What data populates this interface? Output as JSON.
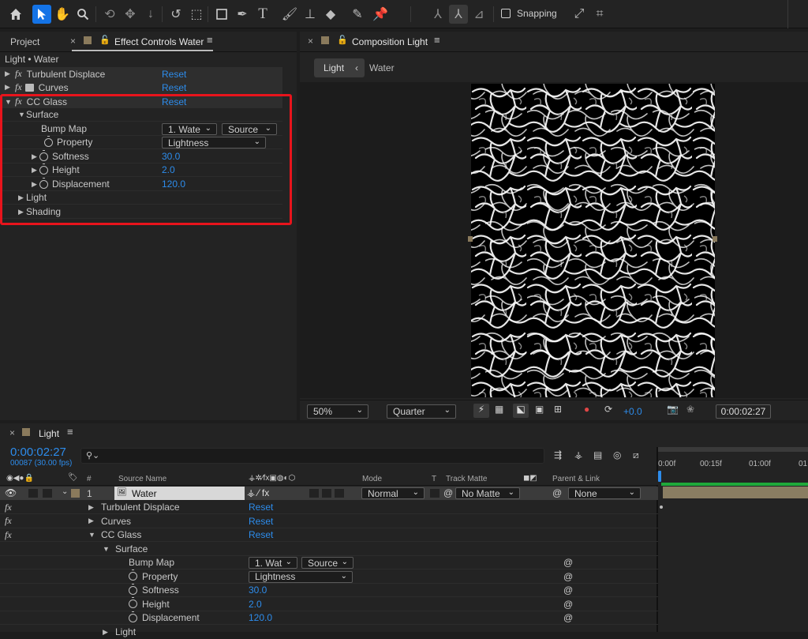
{
  "toolbar": {
    "snapping_label": "Snapping",
    "icons": [
      "home-icon",
      "selection-tool-icon",
      "hand-tool-icon",
      "zoom-tool-icon",
      "orbit-camera-icon",
      "pan-camera-icon",
      "dolly-camera-icon",
      "rotate-tool-icon",
      "pan-behind-icon",
      "rectangle-tool-icon",
      "pen-tool-icon",
      "type-tool-icon",
      "brush-tool-icon",
      "clone-stamp-icon",
      "eraser-icon",
      "roto-brush-icon",
      "puppet-pin-icon"
    ]
  },
  "left_panel": {
    "tab_project": "Project",
    "tab_effect_controls": "Effect Controls Water",
    "breadcrumb": "Light • Water",
    "effects": [
      {
        "name": "Turbulent Displace",
        "reset": "Reset"
      },
      {
        "name": "Curves",
        "reset": "Reset"
      },
      {
        "name": "CC Glass",
        "reset": "Reset"
      }
    ],
    "surface": {
      "label": "Surface",
      "bump_map_label": "Bump Map",
      "bump_map_value": "1. Wate",
      "bump_map_source": "Source",
      "property_label": "Property",
      "property_value": "Lightness",
      "softness_label": "Softness",
      "softness_value": "30.0",
      "height_label": "Height",
      "height_value": "2.0",
      "displacement_label": "Displacement",
      "displacement_value": "120.0"
    },
    "light_label": "Light",
    "shading_label": "Shading"
  },
  "comp_panel": {
    "tab_title": "Composition Light",
    "crumb_light": "Light",
    "crumb_water": "Water",
    "zoom": "50%",
    "resolution": "Quarter",
    "exposure": "+0.0",
    "timecode": "0:00:02:27"
  },
  "timeline": {
    "tab_title": "Light",
    "timecode": "0:00:02:27",
    "frames": "00087 (30.00 fps)",
    "headers": {
      "number": "#",
      "source_name": "Source Name",
      "mode": "Mode",
      "t": "T",
      "track_matte": "Track Matte",
      "parent_link": "Parent & Link"
    },
    "ruler": [
      "0:00f",
      "00:15f",
      "01:00f",
      "01"
    ],
    "layer": {
      "index": "1",
      "name": "Water",
      "mode": "Normal",
      "track_matte": "No Matte",
      "parent": "None"
    },
    "effects": [
      {
        "name": "Turbulent Displace",
        "reset": "Reset"
      },
      {
        "name": "Curves",
        "reset": "Reset"
      },
      {
        "name": "CC Glass",
        "reset": "Reset"
      }
    ],
    "surface": {
      "label": "Surface",
      "bump_map_label": "Bump Map",
      "bump_map_value": "1. Wat",
      "bump_map_source": "Source",
      "property_label": "Property",
      "property_value": "Lightness",
      "softness_label": "Softness",
      "softness_value": "30.0",
      "height_label": "Height",
      "height_value": "2.0",
      "displacement_label": "Displacement",
      "displacement_value": "120.0"
    },
    "light_label": "Light"
  },
  "colors": {
    "accent": "#2d8ceb",
    "highlight_box": "#e8141c",
    "timebar_green": "#1fa83a",
    "layer_bar": "#8a7d62"
  }
}
